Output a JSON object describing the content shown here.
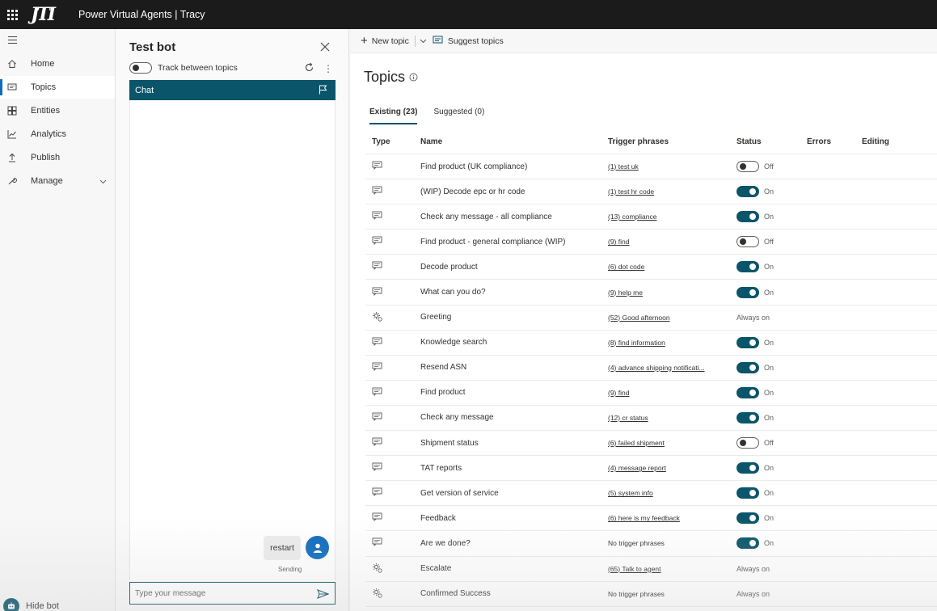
{
  "topbar": {
    "logo_text": "JTI",
    "app_title": "Power Virtual Agents | Tracy"
  },
  "nav": {
    "items": [
      {
        "label": "Home",
        "icon": "home-icon"
      },
      {
        "label": "Topics",
        "icon": "topics-icon",
        "active": true
      },
      {
        "label": "Entities",
        "icon": "entities-icon"
      },
      {
        "label": "Analytics",
        "icon": "analytics-icon"
      },
      {
        "label": "Publish",
        "icon": "publish-icon"
      },
      {
        "label": "Manage",
        "icon": "manage-icon",
        "expandable": true
      }
    ],
    "hide_bot_label": "Hide bot"
  },
  "testbot": {
    "title": "Test bot",
    "track_label": "Track between topics",
    "track_on": false,
    "chat_header": "Chat",
    "bubble_text": "restart",
    "sending_text": "Sending",
    "input_placeholder": "Type your message"
  },
  "commandbar": {
    "new_topic": "New topic",
    "suggest_topics": "Suggest topics"
  },
  "topics": {
    "title": "Topics",
    "tabs": [
      {
        "label": "Existing (23)",
        "active": true
      },
      {
        "label": "Suggested (0)",
        "active": false
      }
    ],
    "columns": {
      "type": "Type",
      "name": "Name",
      "trigger": "Trigger phrases",
      "status": "Status",
      "errors": "Errors",
      "editing": "Editing"
    },
    "rows": [
      {
        "type": "chat",
        "name": "Find product (UK compliance)",
        "trigger": "(1) test uk",
        "status": "off",
        "status_text": "Off"
      },
      {
        "type": "chat",
        "name": "(WIP) Decode epc or hr code",
        "trigger": "(1) test hr code",
        "status": "on",
        "status_text": "On"
      },
      {
        "type": "chat",
        "name": "Check any message - all compliance",
        "trigger": "(13) compliance",
        "status": "on",
        "status_text": "On"
      },
      {
        "type": "chat",
        "name": "Find product - general compliance (WIP)",
        "trigger": "(9) find",
        "status": "off",
        "status_text": "Off"
      },
      {
        "type": "chat",
        "name": "Decode product",
        "trigger": "(6) dot code",
        "status": "on",
        "status_text": "On"
      },
      {
        "type": "chat",
        "name": "What can you do?",
        "trigger": "(9) help me",
        "status": "on",
        "status_text": "On"
      },
      {
        "type": "system",
        "name": "Greeting",
        "trigger": "(52) Good afternoon",
        "status": "always",
        "status_text": "Always on"
      },
      {
        "type": "chat",
        "name": "Knowledge search",
        "trigger": "(8) find information",
        "status": "on",
        "status_text": "On"
      },
      {
        "type": "chat",
        "name": "Resend ASN",
        "trigger": "(4) advance shipping notificati...",
        "status": "on",
        "status_text": "On"
      },
      {
        "type": "chat",
        "name": "Find product",
        "trigger": "(9) find",
        "status": "on",
        "status_text": "On"
      },
      {
        "type": "chat",
        "name": "Check any message",
        "trigger": "(12) cr status",
        "status": "on",
        "status_text": "On"
      },
      {
        "type": "chat",
        "name": "Shipment status",
        "trigger": "(6) failed shipment",
        "status": "off",
        "status_text": "Off"
      },
      {
        "type": "chat",
        "name": "TAT reports",
        "trigger": "(4) message report",
        "status": "on",
        "status_text": "On"
      },
      {
        "type": "chat",
        "name": "Get version of service",
        "trigger": "(5) system info",
        "status": "on",
        "status_text": "On"
      },
      {
        "type": "chat",
        "name": "Feedback",
        "trigger": "(6) here is my feedback",
        "status": "on",
        "status_text": "On"
      },
      {
        "type": "chat",
        "name": "Are we done?",
        "trigger": "No trigger phrases",
        "trigger_is_link": false,
        "status": "on",
        "status_text": "On"
      },
      {
        "type": "system",
        "name": "Escalate",
        "trigger": "(65) Talk to agent",
        "status": "always",
        "status_text": "Always on"
      },
      {
        "type": "system",
        "name": "Confirmed Success",
        "trigger": "No trigger phrases",
        "trigger_is_link": false,
        "status": "always",
        "status_text": "Always on"
      }
    ]
  },
  "colors": {
    "topbar": "#1b1b1b",
    "accent": "#0b556a",
    "nav_bg": "#f7f7f7",
    "link_blue": "#0f6cbd"
  }
}
